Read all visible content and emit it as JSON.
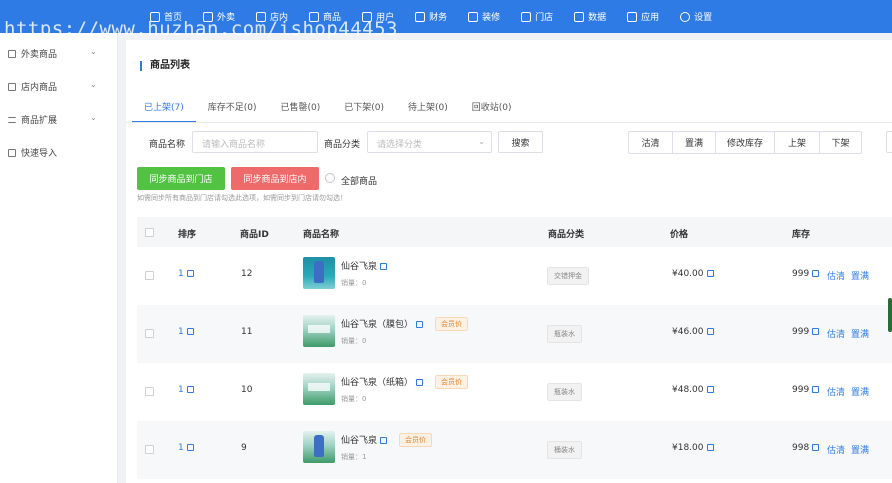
{
  "watermark": "https://www.huzhan.com/ishop44453",
  "topnav": [
    {
      "label": "首页",
      "icon": "home-icon"
    },
    {
      "label": "外卖",
      "icon": "takeout-icon"
    },
    {
      "label": "店内",
      "icon": "store-icon"
    },
    {
      "label": "商品",
      "icon": "goods-icon"
    },
    {
      "label": "用户",
      "icon": "user-icon"
    },
    {
      "label": "财务",
      "icon": "finance-icon"
    },
    {
      "label": "装修",
      "icon": "decorate-icon"
    },
    {
      "label": "门店",
      "icon": "shop-icon"
    },
    {
      "label": "数据",
      "icon": "data-icon"
    },
    {
      "label": "应用",
      "icon": "apps-icon"
    },
    {
      "label": "设置",
      "icon": "settings-icon"
    }
  ],
  "sidebar": [
    {
      "label": "外卖商品",
      "icon": "box-icon",
      "expandable": true
    },
    {
      "label": "店内商品",
      "icon": "box-icon",
      "expandable": true
    },
    {
      "label": "商品扩展",
      "icon": "list-icon",
      "expandable": true
    },
    {
      "label": "快速导入",
      "icon": "import-icon",
      "expandable": false
    }
  ],
  "page_title": "商品列表",
  "tabs": [
    "已上架(7)",
    "库存不足(0)",
    "已售罄(0)",
    "已下架(0)",
    "待上架(0)",
    "回收站(0)"
  ],
  "active_tab": 0,
  "filters": {
    "name_label": "商品名称",
    "name_placeholder": "请输入商品名称",
    "category_label": "商品分类",
    "category_placeholder": "请选择分类",
    "search_label": "搜索"
  },
  "batch_actions": [
    "沽清",
    "置满",
    "修改库存",
    "上架",
    "下架"
  ],
  "sync_buttons": {
    "to_store": "同步商品到门店",
    "to_instore": "同步商品到店内",
    "all_goods": "全部商品"
  },
  "hint": "如需同步所有商品到门店请勾选此选项，如需同步到门店请勿勾选！",
  "table": {
    "headers": [
      "排序",
      "商品ID",
      "商品名称",
      "商品分类",
      "价格",
      "库存"
    ],
    "rows": [
      {
        "sort": "1",
        "id": "12",
        "name": "仙谷飞泉",
        "sales": "销量：0",
        "vip": "",
        "category": "交错押金",
        "price": "¥40.00",
        "stock": "999",
        "thumb": "teal"
      },
      {
        "sort": "1",
        "id": "11",
        "name": "仙谷飞泉（膜包）",
        "sales": "销量：0",
        "vip": "会员价",
        "category": "瓶装水",
        "price": "¥46.00",
        "stock": "999",
        "thumb": "crate"
      },
      {
        "sort": "1",
        "id": "10",
        "name": "仙谷飞泉（纸箱）",
        "sales": "销量：0",
        "vip": "会员价",
        "category": "瓶装水",
        "price": "¥48.00",
        "stock": "999",
        "thumb": "crate"
      },
      {
        "sort": "1",
        "id": "9",
        "name": "仙谷飞泉",
        "sales": "销量：1",
        "vip": "会员价",
        "category": "桶装水",
        "price": "¥18.00",
        "stock": "998",
        "thumb": "crate"
      }
    ],
    "row_actions": [
      "估清",
      "置满"
    ]
  }
}
